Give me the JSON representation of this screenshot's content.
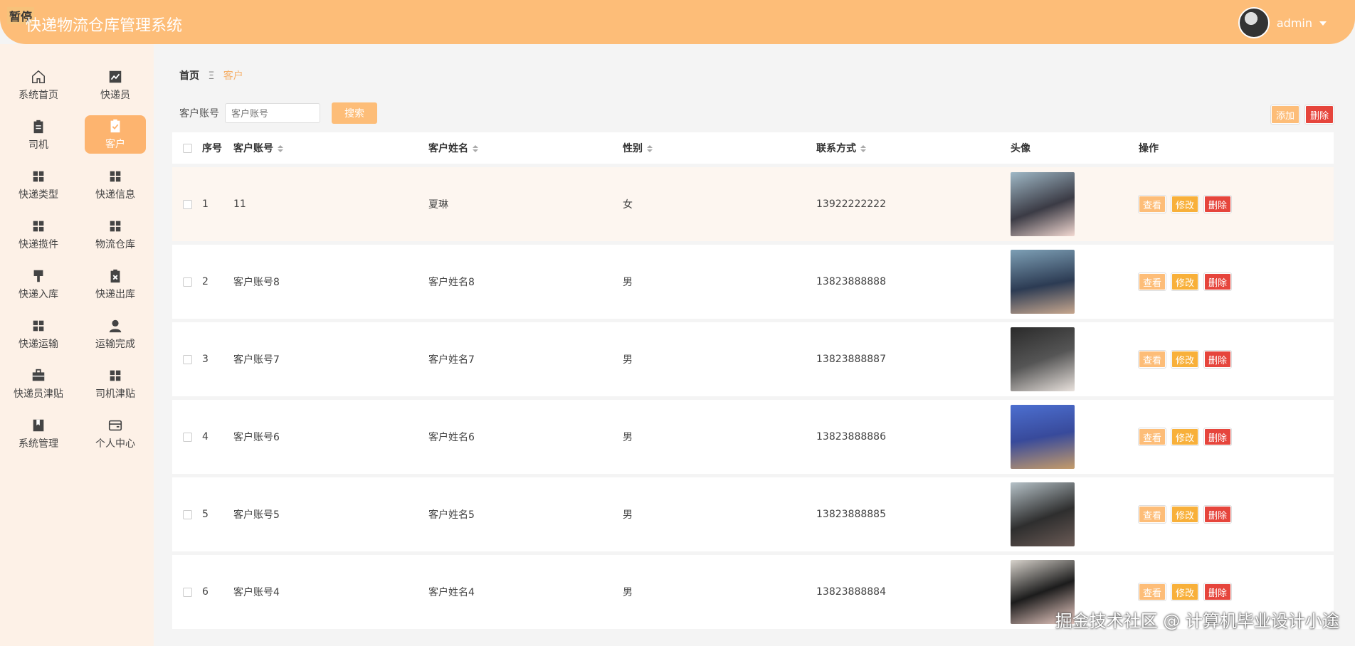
{
  "header": {
    "badge": "暂停",
    "title": "快递物流仓库管理系统",
    "user": "admin"
  },
  "sidebar": {
    "items": [
      {
        "label": "系统首页",
        "icon": "home-icon"
      },
      {
        "label": "快递员",
        "icon": "chart-icon"
      },
      {
        "label": "司机",
        "icon": "clipboard-icon"
      },
      {
        "label": "客户",
        "icon": "clipboard-check-icon",
        "active": true
      },
      {
        "label": "快递类型",
        "icon": "grid-icon"
      },
      {
        "label": "快递信息",
        "icon": "grid-icon"
      },
      {
        "label": "快递揽件",
        "icon": "grid-icon"
      },
      {
        "label": "物流仓库",
        "icon": "grid-icon"
      },
      {
        "label": "快递入库",
        "icon": "brush-icon"
      },
      {
        "label": "快递出库",
        "icon": "delete-clipboard-icon"
      },
      {
        "label": "快递运输",
        "icon": "grid-icon"
      },
      {
        "label": "运输完成",
        "icon": "user-icon"
      },
      {
        "label": "快递员津贴",
        "icon": "briefcase-icon"
      },
      {
        "label": "司机津贴",
        "icon": "grid-icon"
      },
      {
        "label": "系统管理",
        "icon": "book-icon"
      },
      {
        "label": "个人中心",
        "icon": "wallet-icon"
      }
    ]
  },
  "breadcrumb": {
    "home": "首页",
    "sep": "Ξ",
    "current": "客户"
  },
  "search": {
    "label": "客户账号",
    "placeholder": "客户账号",
    "button": "搜索"
  },
  "actions": {
    "add": "添加",
    "delete": "删除"
  },
  "table": {
    "headers": {
      "index": "序号",
      "account": "客户账号",
      "name": "客户姓名",
      "gender": "性别",
      "phone": "联系方式",
      "avatar": "头像",
      "ops": "操作"
    },
    "op_labels": {
      "view": "查看",
      "edit": "修改",
      "delete": "删除"
    },
    "rows": [
      {
        "index": "1",
        "account": "11",
        "name": "夏琳",
        "gender": "女",
        "phone": "13922222222"
      },
      {
        "index": "2",
        "account": "客户账号8",
        "name": "客户姓名8",
        "gender": "男",
        "phone": "13823888888"
      },
      {
        "index": "3",
        "account": "客户账号7",
        "name": "客户姓名7",
        "gender": "男",
        "phone": "13823888887"
      },
      {
        "index": "4",
        "account": "客户账号6",
        "name": "客户姓名6",
        "gender": "男",
        "phone": "13823888886"
      },
      {
        "index": "5",
        "account": "客户账号5",
        "name": "客户姓名5",
        "gender": "男",
        "phone": "13823888885"
      },
      {
        "index": "6",
        "account": "客户账号4",
        "name": "客户姓名4",
        "gender": "男",
        "phone": "13823888884"
      }
    ]
  },
  "watermark": "掘金技术社区 @ 计算机毕业设计小途"
}
